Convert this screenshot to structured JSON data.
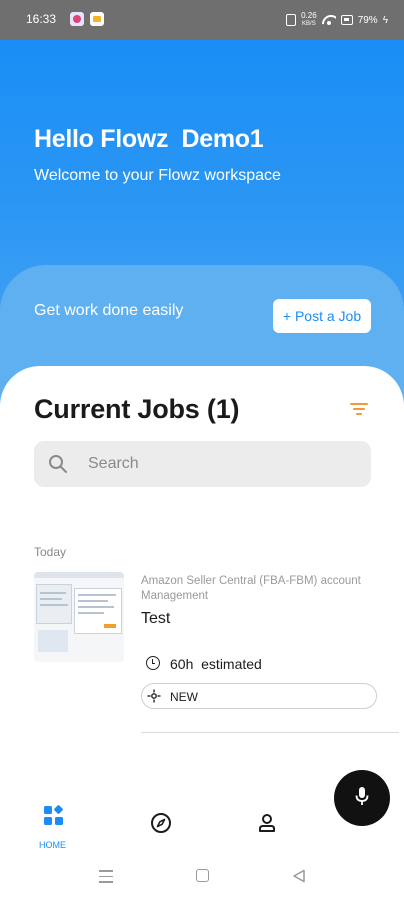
{
  "status_bar": {
    "time": "16:33",
    "network_speed_value": "0.26",
    "network_speed_unit": "KB/S",
    "battery": "79%"
  },
  "header": {
    "greeting": "Hello Flowz  Demo1",
    "welcome": "Welcome to your Flowz workspace"
  },
  "post_job": {
    "prompt": "Get work done easily",
    "button_label": "+ Post a Job"
  },
  "jobs": {
    "title": "Current Jobs (1)",
    "search_placeholder": "Search",
    "sections": [
      {
        "date_label": "Today",
        "items": [
          {
            "category": "Amazon Seller Central (FBA-FBM) account Management",
            "title": "Test",
            "estimate": "60h  estimated",
            "status": "NEW"
          }
        ]
      }
    ]
  },
  "bottom_nav": {
    "items": [
      {
        "label": "HOME",
        "icon": "home-grid-icon",
        "active": true
      },
      {
        "label": "",
        "icon": "compass-icon",
        "active": false
      },
      {
        "label": "",
        "icon": "profile-icon",
        "active": false
      }
    ]
  },
  "fab": {
    "icon": "microphone-icon"
  },
  "colors": {
    "primary": "#1a8ef6",
    "accent_filter": "#f09a3a",
    "fab": "#111111"
  }
}
